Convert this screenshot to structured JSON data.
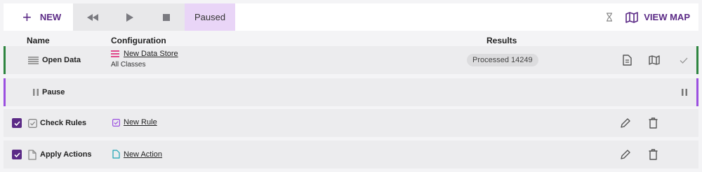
{
  "toolbar": {
    "new_label": "NEW",
    "status_label": "Paused",
    "view_map_label": "VIEW MAP"
  },
  "columns": {
    "name": "Name",
    "configuration": "Configuration",
    "results": "Results"
  },
  "rows": [
    {
      "name": "Open Data",
      "config_link": "New Data Store",
      "config_sub": "All Classes",
      "results": "Processed 14249",
      "status": "complete"
    },
    {
      "name": "Pause"
    },
    {
      "name": "Check Rules",
      "config_link": "New Rule",
      "checked": true
    },
    {
      "name": "Apply Actions",
      "config_link": "New Action",
      "checked": true
    }
  ],
  "colors": {
    "accent": "#5b2a86",
    "complete": "#2e8540",
    "pause": "#9b50e0",
    "paused_pill": "#e9d5f7"
  },
  "icons": [
    "plus-icon",
    "rewind-icon",
    "play-icon",
    "stop-icon",
    "hourglass-icon",
    "map-icon",
    "list-icon",
    "database-icon",
    "document-icon",
    "check-icon",
    "pause-icon",
    "checkbox-icon",
    "file-icon",
    "pencil-icon",
    "trash-icon"
  ]
}
